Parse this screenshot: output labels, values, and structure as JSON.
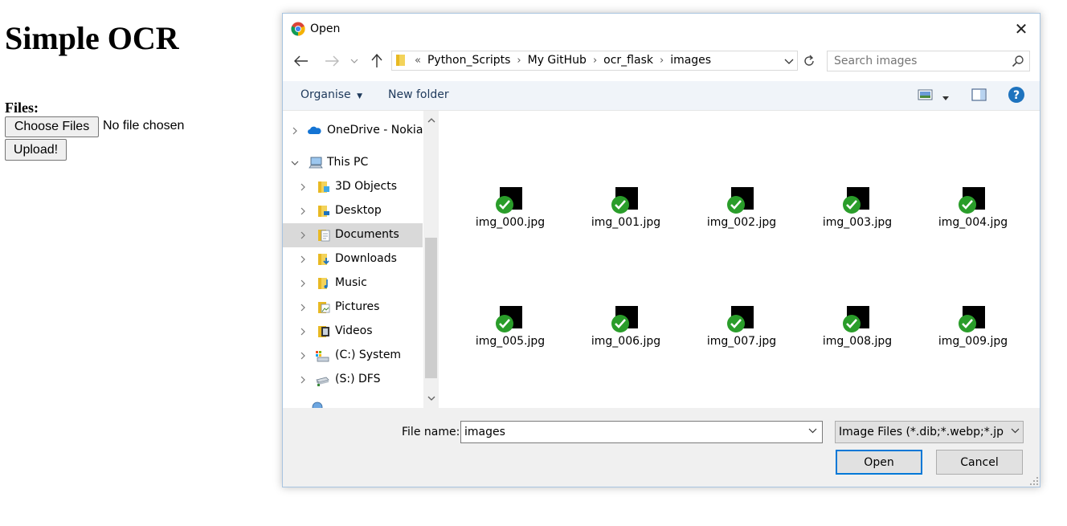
{
  "page": {
    "title": "Simple OCR",
    "files_label": "Files:",
    "choose_button": "Choose Files",
    "no_file_text": "No file chosen",
    "upload_button": "Upload!"
  },
  "dialog": {
    "title": "Open",
    "breadcrumb": {
      "overflow": "«",
      "items": [
        "Python_Scripts",
        "My GitHub",
        "ocr_flask",
        "images"
      ]
    },
    "search_placeholder": "Search images",
    "toolbar": {
      "organise": "Organise",
      "new_folder": "New folder"
    },
    "nav_tree": [
      {
        "label": "OneDrive - Nokia",
        "icon": "onedrive-cloud-icon"
      },
      {
        "label": "This PC",
        "icon": "computer-icon"
      },
      {
        "label": "3D Objects",
        "icon": "folder-3d-icon"
      },
      {
        "label": "Desktop",
        "icon": "folder-desktop-icon"
      },
      {
        "label": "Documents",
        "icon": "folder-documents-icon"
      },
      {
        "label": "Downloads",
        "icon": "folder-downloads-icon"
      },
      {
        "label": "Music",
        "icon": "folder-music-icon"
      },
      {
        "label": "Pictures",
        "icon": "folder-pictures-icon"
      },
      {
        "label": "Videos",
        "icon": "folder-videos-icon"
      },
      {
        "label": "(C:) System",
        "icon": "drive-c-icon"
      },
      {
        "label": "(S:) DFS",
        "icon": "network-drive-icon"
      }
    ],
    "files": [
      "img_000.jpg",
      "img_001.jpg",
      "img_002.jpg",
      "img_003.jpg",
      "img_004.jpg",
      "img_005.jpg",
      "img_006.jpg",
      "img_007.jpg",
      "img_008.jpg",
      "img_009.jpg"
    ],
    "file_name_label": "File name:",
    "file_name_value": "images",
    "file_type_filter": "Image Files (*.dib;*.webp;*.jpeg;",
    "open_button": "Open",
    "cancel_button": "Cancel"
  },
  "colors": {
    "toolbar_bg": "#f0f4f9",
    "accent": "#0078d7",
    "check_green": "#2a9d2a",
    "help_blue": "#1e73be"
  }
}
